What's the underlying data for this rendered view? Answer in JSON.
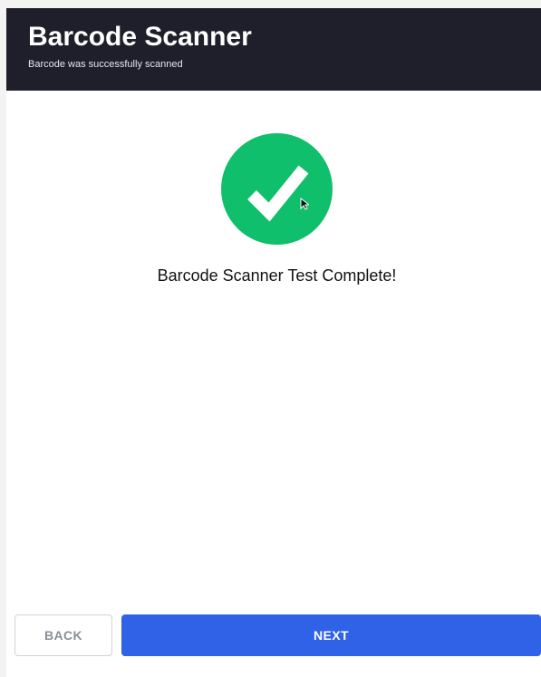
{
  "header": {
    "title": "Barcode Scanner",
    "subtitle": "Barcode was successfully scanned"
  },
  "content": {
    "status_icon": "check-icon",
    "message": "Barcode Scanner Test Complete!",
    "colors": {
      "success": "#0fbf6b",
      "icon": "#ffffff"
    }
  },
  "footer": {
    "back_label": "BACK",
    "next_label": "NEXT"
  },
  "theme": {
    "header_background": "#1f1f2b",
    "primary": "#2f62e6",
    "back_text": "#8b8f98"
  }
}
